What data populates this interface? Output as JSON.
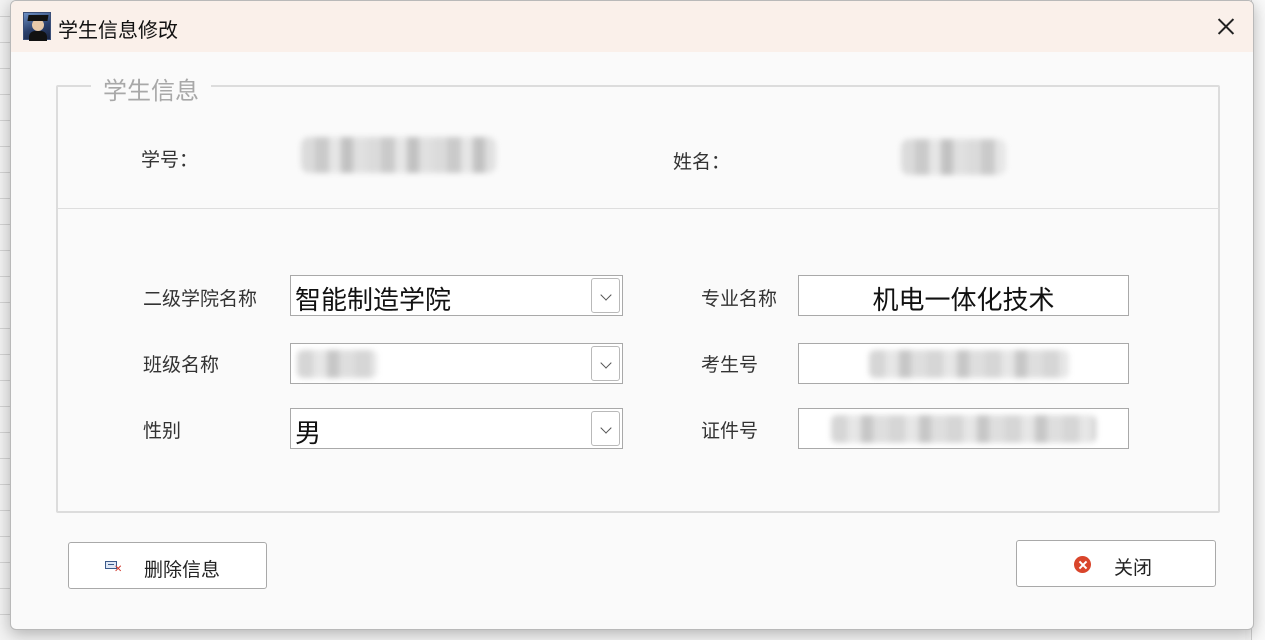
{
  "window": {
    "title": "学生信息修改"
  },
  "group": {
    "legend": "学生信息"
  },
  "info": {
    "student_id_label": "学号：",
    "name_label": "姓名："
  },
  "form": {
    "college_label": "二级学院名称",
    "college_value": "智能制造学院",
    "major_label": "专业名称",
    "major_value": "机电一体化技术",
    "class_label": "班级名称",
    "exam_no_label": "考生号",
    "gender_label": "性别",
    "gender_value": "男",
    "id_card_label": "证件号"
  },
  "buttons": {
    "delete_label": "删除信息",
    "close_label": "关闭"
  },
  "icons": {
    "app": "student-avatar-icon",
    "close": "close-icon",
    "delete": "delete-card-icon",
    "cancel": "cancel-circle-icon",
    "dropdown": "chevron-down-icon"
  },
  "colors": {
    "titlebar": "#faf0ea",
    "cancel_icon": "#d9452b"
  }
}
